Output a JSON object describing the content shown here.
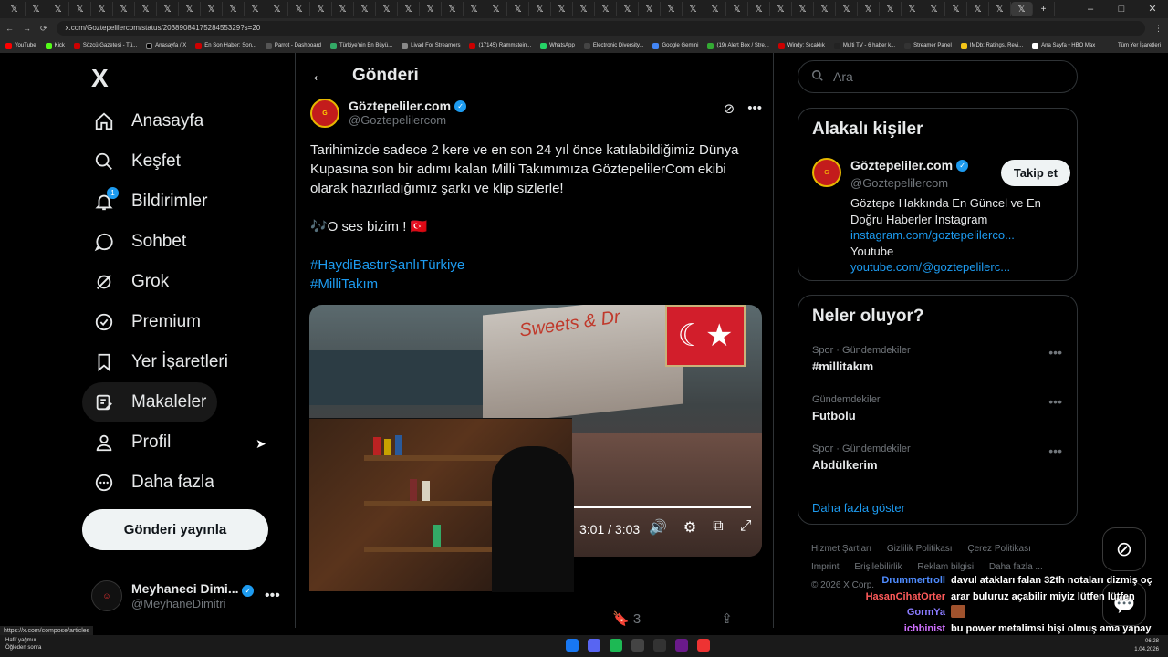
{
  "browser": {
    "url": "x.com/Goztepelilercom/status/2038908417528455329?s=20",
    "bookmarks": [
      "YouTube",
      "Kick",
      "Sözcü Gazetesi - Tü...",
      "Anasayfa / X",
      "En Son Haber: Son...",
      "Parrot - Dashboard",
      "Türkiye'nin En Büyü...",
      "Livad For Streamers",
      "(17145) Rammstein...",
      "WhatsApp",
      "Electronic Diversity...",
      "Google Gemini",
      "(19) Alert Box / Stre...",
      "Windy: Sıcaklık",
      "Multi TV - 6 haber k...",
      "Streamer Panel",
      "IMDb: Ratings, Revi...",
      "Ana Sayfa • HBO Max"
    ],
    "bookmarks_right": "Tüm Yer İşaretleri",
    "status_url": "https://x.com/compose/articles"
  },
  "nav": {
    "logo": "X",
    "items": [
      {
        "label": "Anasayfa",
        "icon": "home-icon"
      },
      {
        "label": "Keşfet",
        "icon": "search-icon"
      },
      {
        "label": "Bildirimler",
        "icon": "bell-icon",
        "badge": "1"
      },
      {
        "label": "Sohbet",
        "icon": "chat-icon"
      },
      {
        "label": "Grok",
        "icon": "grok-icon"
      },
      {
        "label": "Premium",
        "icon": "premium-icon"
      },
      {
        "label": "Yer İşaretleri",
        "icon": "bookmark-icon"
      },
      {
        "label": "Makaleler",
        "icon": "article-icon"
      },
      {
        "label": "Profil",
        "icon": "profile-icon"
      },
      {
        "label": "Daha fazla",
        "icon": "more-icon"
      }
    ],
    "post_button": "Gönderi yayınla",
    "account": {
      "name": "Meyhaneci Dimi...",
      "handle": "@MeyhaneDimitri"
    }
  },
  "main": {
    "title": "Gönderi",
    "author": {
      "name": "Göztepeliler.com",
      "handle": "@Goztepelilercom"
    },
    "text1": "Tarihimizde sadece 2 kere ve en son 24 yıl önce katılabildiğimiz Dünya Kupasına son bir adımı kalan Milli Takımımıza GöztepelilerCom ekibi olarak hazırladığımız şarkı ve klip sizlerle!",
    "text2": "🎶O ses bizim ! 🇹🇷",
    "hashtags": [
      "#HaydiBastırŞanlıTürkiye",
      "#MilliTakım"
    ],
    "video": {
      "time": "3:01 / 3:03",
      "progress": 0.99
    },
    "bookmark_count": "3"
  },
  "right": {
    "search_placeholder": "Ara",
    "related": {
      "title": "Alakalı kişiler",
      "name": "Göztepeliler.com",
      "handle": "@Goztepelilercom",
      "follow": "Takip et",
      "bio1": "Göztepe Hakkında En Güncel ve En Doğru Haberler İnstagram",
      "link1": "instagram.com/goztepelilerco...",
      "bio2": "Youtube",
      "link2": "youtube.com/@goztepelilerc..."
    },
    "trends": {
      "title": "Neler oluyor?",
      "items": [
        {
          "meta": "Spor · Gündemdekiler",
          "name": "#millitakım"
        },
        {
          "meta": "Gündemdekiler",
          "name": "Futbolu"
        },
        {
          "meta": "Spor · Gündemdekiler",
          "name": "Abdülkerim"
        }
      ],
      "show_more": "Daha fazla göster"
    },
    "footer": [
      "Hizmet Şartları",
      "Gizlilik Politikası",
      "Çerez Politikası",
      "Imprint",
      "Erişilebilirlik",
      "Reklam bilgisi",
      "Daha fazla ...",
      "© 2026 X Corp."
    ]
  },
  "chat": [
    {
      "user": "Drummertroll",
      "color": "#4f8cff",
      "msg": "davul atakları falan 32th notaları dizmiş oç"
    },
    {
      "user": "HasanCihatOrter",
      "color": "#ff5a5a",
      "msg": "arar buluruz açabilir miyiz lütfen lütfen"
    },
    {
      "user": "GormYa",
      "color": "#8a7bff",
      "msg": ""
    },
    {
      "user": "ichbinist",
      "color": "#d070ff",
      "msg": "bu power metalimsi bişi olmuş ama yapay zeka malesef"
    }
  ],
  "taskbar": {
    "weather_line1": "Hafif yağmur",
    "weather_line2": "Öğleden sonra",
    "time": "06:28",
    "date": "1.04.2026"
  }
}
